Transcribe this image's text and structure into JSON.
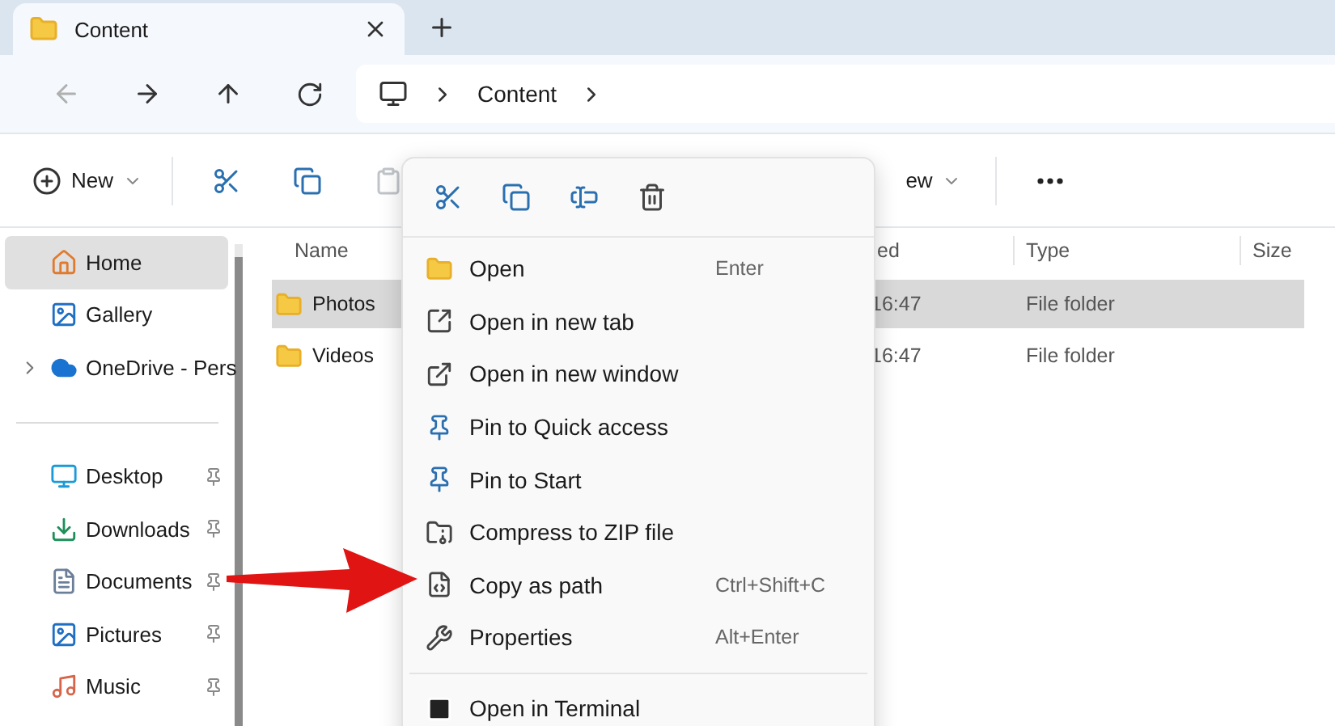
{
  "tabs": [
    {
      "title": "Content",
      "selected": true
    }
  ],
  "nav": {
    "back_disabled": true,
    "forward_disabled": false
  },
  "address": {
    "segments": [
      "Content"
    ]
  },
  "toolbar": {
    "new_label": "New",
    "paste_disabled": true,
    "view_label_partial": "ew"
  },
  "sidebar": {
    "items": [
      {
        "label": "Home",
        "selected": true,
        "pinned": false,
        "expandable": false
      },
      {
        "label": "Gallery",
        "selected": false,
        "pinned": false,
        "expandable": false
      },
      {
        "label": "OneDrive - Pers",
        "selected": false,
        "pinned": false,
        "expandable": true
      }
    ],
    "pinned_items": [
      {
        "label": "Desktop",
        "selected": false,
        "pinned": true
      },
      {
        "label": "Downloads",
        "selected": false,
        "pinned": true
      },
      {
        "label": "Documents",
        "selected": false,
        "pinned": true
      },
      {
        "label": "Pictures",
        "selected": false,
        "pinned": true
      },
      {
        "label": "Music",
        "selected": false,
        "pinned": true
      }
    ]
  },
  "table": {
    "columns": [
      "Name",
      "ed",
      "Type",
      "Size"
    ],
    "rows": [
      {
        "name": "Photos",
        "date": "16:47",
        "type": "File folder",
        "selected": true
      },
      {
        "name": "Videos",
        "date": "16:47",
        "type": "File folder",
        "selected": false
      }
    ]
  },
  "context_menu": {
    "groups": [
      [
        {
          "label": "Open",
          "shortcut": "Enter"
        },
        {
          "label": "Open in new tab"
        },
        {
          "label": "Open in new window"
        },
        {
          "label": "Pin to Quick access"
        },
        {
          "label": "Pin to Start"
        },
        {
          "label": "Compress to ZIP file"
        },
        {
          "label": "Copy as path",
          "shortcut": "Ctrl+Shift+C"
        },
        {
          "label": "Properties",
          "shortcut": "Alt+Enter"
        }
      ],
      [
        {
          "label": "Open in Terminal"
        }
      ]
    ]
  }
}
